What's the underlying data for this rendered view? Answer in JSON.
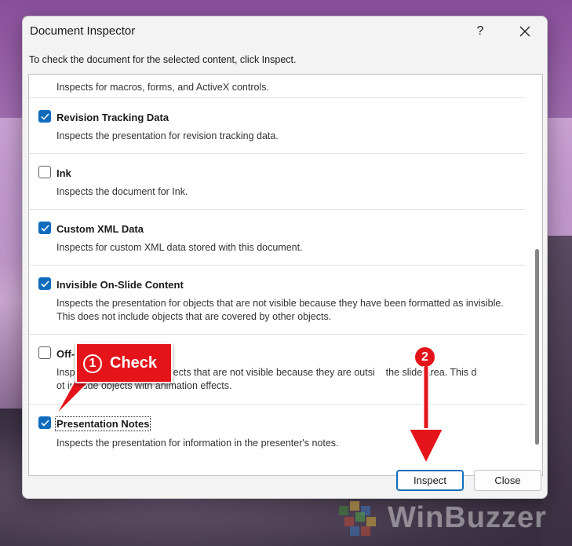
{
  "dialog": {
    "title": "Document Inspector",
    "help_label": "?",
    "instruction": "To check the document for the selected content, click Inspect."
  },
  "items": [
    {
      "name": "",
      "checked": true,
      "desc": "Inspects for macros, forms, and ActiveX controls."
    },
    {
      "name": "Revision Tracking Data",
      "checked": true,
      "desc": "Inspects the presentation for revision tracking data."
    },
    {
      "name": "Ink",
      "checked": false,
      "desc": "Inspects the document for Ink."
    },
    {
      "name": "Custom XML Data",
      "checked": true,
      "desc": "Inspects for custom XML data stored with this document."
    },
    {
      "name": "Invisible On-Slide Content",
      "checked": true,
      "desc": "Inspects the presentation for objects that are not visible because they have been formatted as invisible. This does not include objects that are covered by other objects."
    },
    {
      "name": "Off-",
      "checked": false,
      "desc": "Insp                          for objects that are not visible because they are outsi    the slide area. This d         ot include objects with animation effects."
    },
    {
      "name": "Presentation Notes",
      "checked": true,
      "desc": "Inspects the presentation for information in the presenter's notes."
    }
  ],
  "buttons": {
    "inspect": "Inspect",
    "close": "Close"
  },
  "annotations": {
    "step1_number": "1",
    "step1_label": "Check",
    "step2_number": "2"
  },
  "watermark": {
    "text": "WinBuzzer"
  },
  "colors": {
    "accent": "#0f6cbd",
    "callout": "#e4141a"
  }
}
